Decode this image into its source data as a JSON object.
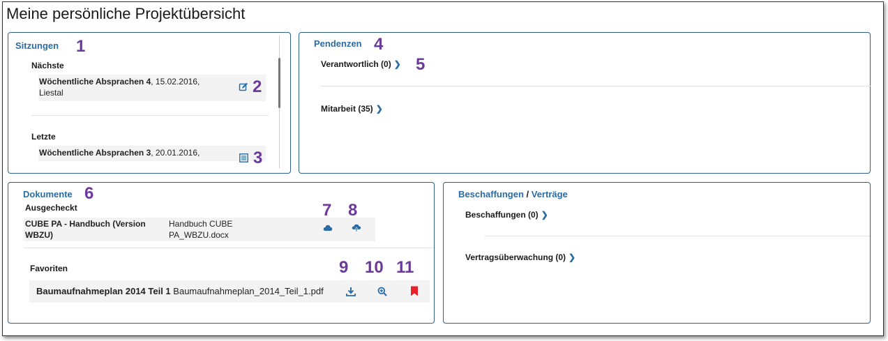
{
  "page": {
    "title": "Meine persönliche Projektübersicht"
  },
  "sitzungen": {
    "title": "Sitzungen",
    "marker": "1",
    "next_label": "Nächste",
    "next_item": {
      "name": "Wöchentliche Absprachen 4",
      "details_line1": ", 15.02.2016,",
      "details_line2": "Liestal",
      "icon": "edit-icon",
      "marker": "2"
    },
    "last_label": "Letzte",
    "last_item": {
      "name": "Wöchentliche Absprachen 3",
      "details_line1": ", 20.01.2016,",
      "icon": "protocol-icon",
      "marker": "3"
    }
  },
  "pendenzen": {
    "title": "Pendenzen",
    "marker": "4",
    "verantwortlich": "Verantwortlich (0)",
    "verantwortlich_marker": "5",
    "mitarbeit": "Mitarbeit (35)"
  },
  "dokumente": {
    "title": "Dokumente",
    "marker": "6",
    "checked_out_label": "Ausgecheckt",
    "checked_out_item": {
      "name_line1": "CUBE PA - Handbuch (Version",
      "name_line2": "WBZU)",
      "file_line1": "Handbuch CUBE",
      "file_line2": "PA_WBZU.docx"
    },
    "icon_markers": [
      "7",
      "8"
    ],
    "favorites_label": "Favoriten",
    "favorite_item": {
      "name": "Baumaufnahmeplan 2014 Teil 1",
      "file": "Baumaufnahmeplan_2014_Teil_1.pdf"
    },
    "favorite_markers": [
      "9",
      "10",
      "11"
    ]
  },
  "beschaffungen": {
    "title_part1": "Beschaffungen",
    "separator": " / ",
    "title_part2": "Verträge",
    "beschaffungen_link": "Beschaffungen (0)",
    "vertrag_link": "Vertragsüberwachung (0)"
  },
  "colors": {
    "accent": "#2a6ca3",
    "marker": "#6b3a9a",
    "bookmark": "#e8202a"
  }
}
